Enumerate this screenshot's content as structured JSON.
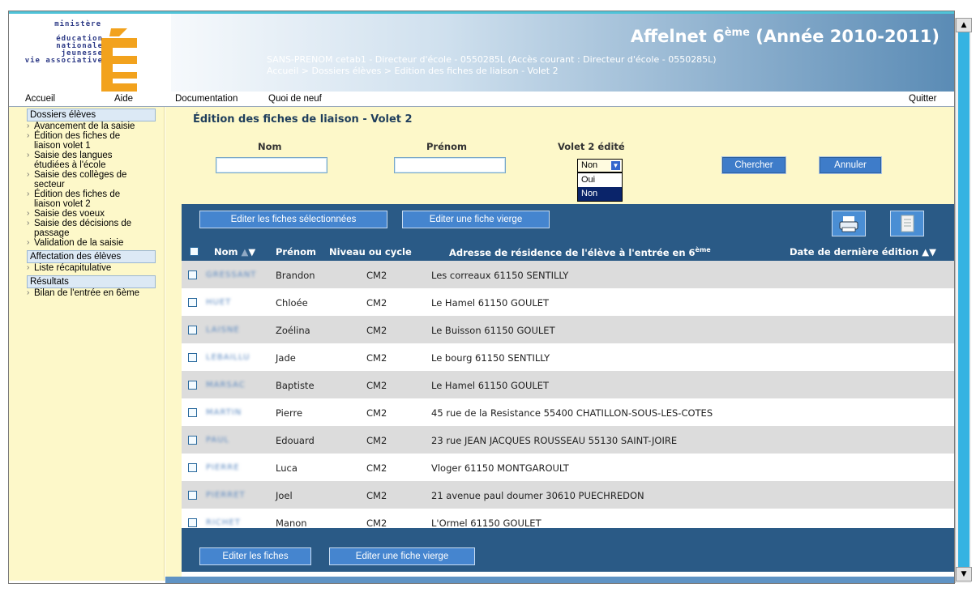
{
  "header": {
    "logo_lines": [
      "ministère",
      "éducation",
      "nationale",
      "jeunesse",
      "vie associative"
    ],
    "title_main": "Affelnet 6",
    "title_sup": "ème",
    "title_tail": " (Année 2010-2011)",
    "user_info": "SANS-PRENOM cetab1 - Directeur d'école - 0550285L (Accès courant : Directeur d'école - 0550285L)",
    "breadcrumb": "Accueil > Dossiers élèves > Edition des fiches de liaison - Volet 2"
  },
  "nav": {
    "accueil": "Accueil",
    "aide": "Aide",
    "documentation": "Documentation",
    "quoi_de_neuf": "Quoi de neuf",
    "quitter": "Quitter"
  },
  "sidebar": {
    "sections": [
      {
        "title": "Dossiers élèves",
        "items": [
          "Avancement de la saisie",
          "Édition des fiches de liaison volet 1",
          "Saisie des langues étudiées à l'école",
          "Saisie des collèges de secteur",
          "Édition des fiches de liaison volet 2",
          "Saisie des voeux",
          "Saisie des décisions de passage",
          "Validation de la saisie"
        ]
      },
      {
        "title": "Affectation des élèves",
        "items": [
          "Liste récapitulative"
        ]
      },
      {
        "title": "Résultats",
        "items": [
          "Bilan de l'entrée en 6ème"
        ]
      }
    ]
  },
  "main": {
    "page_title": "Édition des fiches de liaison - Volet 2",
    "filters": {
      "nom_label": "Nom",
      "prenom_label": "Prénom",
      "volet_label": "Volet 2 édité",
      "volet_value": "Non",
      "volet_options": [
        "Oui",
        "Non"
      ],
      "search_button": "Chercher",
      "cancel_button": "Annuler"
    },
    "toolbar": {
      "edit_selected": "Editer les fiches sélectionnées",
      "edit_blank": "Editer une fiche vierge"
    },
    "table": {
      "headers": {
        "nom": "Nom",
        "prenom": "Prénom",
        "niveau": "Niveau ou cycle",
        "adresse": "Adresse de résidence de l'élève à l'entrée en 6",
        "adresse_sup": "ème",
        "date": "Date de dernière édition"
      },
      "rows": [
        {
          "nom": "GRESSANT",
          "prenom": "Brandon",
          "niveau": "CM2",
          "adresse": "Les correaux 61150 SENTILLY"
        },
        {
          "nom": "HUET",
          "prenom": "Chloée",
          "niveau": "CM2",
          "adresse": "Le Hamel 61150 GOULET"
        },
        {
          "nom": "LAISNE",
          "prenom": "Zoélina",
          "niveau": "CM2",
          "adresse": "Le Buisson 61150 GOULET"
        },
        {
          "nom": "LEBAILLU",
          "prenom": "Jade",
          "niveau": "CM2",
          "adresse": "Le bourg 61150 SENTILLY"
        },
        {
          "nom": "MARSAC",
          "prenom": "Baptiste",
          "niveau": "CM2",
          "adresse": "Le Hamel 61150 GOULET"
        },
        {
          "nom": "MARTIN",
          "prenom": "Pierre",
          "niveau": "CM2",
          "adresse": "45 rue de la Resistance 55400 CHATILLON-SOUS-LES-COTES"
        },
        {
          "nom": "PAUL",
          "prenom": "Edouard",
          "niveau": "CM2",
          "adresse": "23 rue JEAN JACQUES ROUSSEAU 55130 SAINT-JOIRE"
        },
        {
          "nom": "PIERRE",
          "prenom": "Luca",
          "niveau": "CM2",
          "adresse": "Vloger 61150 MONTGAROULT"
        },
        {
          "nom": "PIERRET",
          "prenom": "Joel",
          "niveau": "CM2",
          "adresse": "21 avenue paul doumer 30610 PUECHREDON"
        },
        {
          "nom": "RICHET",
          "prenom": "Manon",
          "niveau": "CM2",
          "adresse": "L'Ormel 61150 GOULET"
        }
      ]
    },
    "footer": {
      "edit_fiches": "Editer les fiches",
      "edit_blank": "Editer une fiche vierge"
    }
  },
  "colors": {
    "header_blue": "#5a8bb5",
    "panel_blue": "#2a5a86",
    "button_blue": "#4585cf",
    "sidebar_yellow": "#fdf8c9"
  },
  "icons": {
    "print": "printer-icon",
    "doc": "document-icon"
  }
}
